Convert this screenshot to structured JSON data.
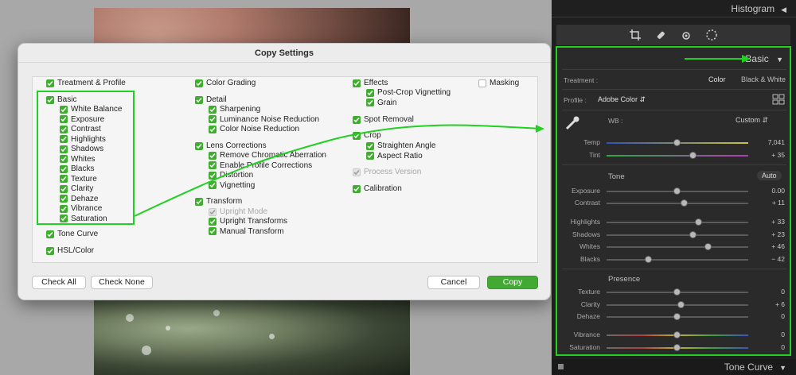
{
  "dialog": {
    "title": "Copy Settings",
    "buttons": {
      "check_all": "Check All",
      "check_none": "Check None",
      "cancel": "Cancel",
      "copy": "Copy"
    }
  },
  "col1": {
    "treatment": "Treatment & Profile",
    "basic": "Basic",
    "basic_items": [
      "White Balance",
      "Exposure",
      "Contrast",
      "Highlights",
      "Shadows",
      "Whites",
      "Blacks",
      "Texture",
      "Clarity",
      "Dehaze",
      "Vibrance",
      "Saturation"
    ],
    "tone_curve": "Tone Curve",
    "hsl": "HSL/Color"
  },
  "col2": {
    "color_grading": "Color Grading",
    "detail": "Detail",
    "detail_items": [
      "Sharpening",
      "Luminance Noise Reduction",
      "Color Noise Reduction"
    ],
    "lens": "Lens Corrections",
    "lens_items": [
      "Remove Chromatic Aberration",
      "Enable Profile Corrections",
      "Distortion",
      "Vignetting"
    ],
    "transform": "Transform",
    "upright_mode": "Upright Mode",
    "transform_items": [
      "Upright Transforms",
      "Manual Transform"
    ]
  },
  "col3": {
    "effects": "Effects",
    "effects_items": [
      "Post-Crop Vignetting",
      "Grain"
    ],
    "spot_removal": "Spot Removal",
    "crop": "Crop",
    "crop_items": [
      "Straighten Angle",
      "Aspect Ratio"
    ],
    "process_version": "Process Version",
    "calibration": "Calibration"
  },
  "col4": {
    "masking": "Masking"
  },
  "panel": {
    "histogram": "Histogram",
    "basic": "Basic",
    "treatment_label": "Treatment :",
    "treatment_color": "Color",
    "treatment_bw": "Black & White",
    "profile_label": "Profile :",
    "profile_value": "Adobe Color",
    "wb_label": "WB :",
    "wb_value": "Custom",
    "tone_label": "Tone",
    "auto": "Auto",
    "presence_label": "Presence",
    "tone_curve": "Tone Curve",
    "sliders": [
      {
        "label": "Temp",
        "value": "7,041",
        "pos": 0.5
      },
      {
        "label": "Tint",
        "value": "+ 35",
        "pos": 0.61
      },
      {
        "label": "Exposure",
        "value": "0.00",
        "pos": 0.5
      },
      {
        "label": "Contrast",
        "value": "+ 11",
        "pos": 0.55
      },
      {
        "label": "Highlights",
        "value": "+ 33",
        "pos": 0.65
      },
      {
        "label": "Shadows",
        "value": "+ 23",
        "pos": 0.61
      },
      {
        "label": "Whites",
        "value": "+ 46",
        "pos": 0.72
      },
      {
        "label": "Blacks",
        "value": "− 42",
        "pos": 0.3
      },
      {
        "label": "Texture",
        "value": "0",
        "pos": 0.5
      },
      {
        "label": "Clarity",
        "value": "+ 6",
        "pos": 0.53
      },
      {
        "label": "Dehaze",
        "value": "0",
        "pos": 0.5
      },
      {
        "label": "Vibrance",
        "value": "0",
        "pos": 0.5
      },
      {
        "label": "Saturation",
        "value": "0",
        "pos": 0.5
      }
    ]
  },
  "colors": {
    "accent_green": "#41a934",
    "annotation_green": "#22d022"
  }
}
